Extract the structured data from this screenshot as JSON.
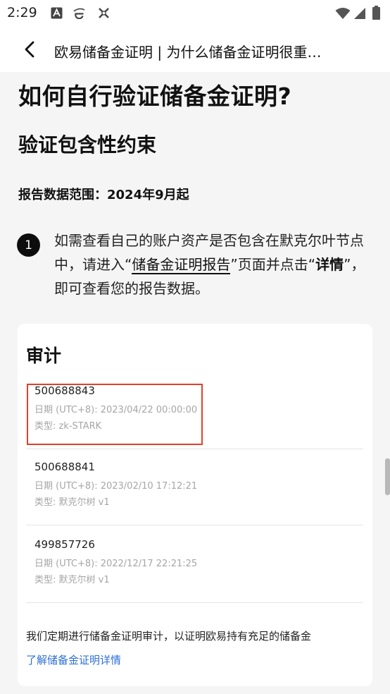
{
  "status_bar": {
    "time": "2:29",
    "left_icons": [
      "font-a-icon",
      "browser-e-icon",
      "xiaomi-icon"
    ],
    "right_icons": [
      "wifi-icon",
      "signal-icon",
      "battery-icon"
    ]
  },
  "app_bar": {
    "title": "欧易储备金证明 | 为什么储备金证明很重…"
  },
  "article": {
    "heading": "如何自行验证储备金证明?",
    "subheading": "验证包含性约束",
    "data_scope": "报告数据范围：2024年9月起",
    "step": {
      "number": "1",
      "text_before": "如需查看自己的账户资产是否包含在默克尔叶节点中，请进入“",
      "link_text": "储备金证明报告",
      "text_middle": "”页面并点击“",
      "bold_text": "详情",
      "text_after": "”，即可查看您的报告数据。"
    }
  },
  "audit_card": {
    "title": "审计",
    "records": [
      {
        "id": "500688843",
        "date": "日期 (UTC+8): 2023/04/22 00:00:00",
        "type": "类型: zk-STARK"
      },
      {
        "id": "500688841",
        "date": "日期 (UTC+8): 2023/02/10 17:12:21",
        "type": "类型: 默克尔树 v1"
      },
      {
        "id": "499857726",
        "date": "日期 (UTC+8): 2022/12/17 22:21:25",
        "type": "类型: 默克尔树 v1"
      }
    ],
    "description": "我们定期进行储备金证明审计，以证明欧易持有充足的储备金",
    "learn_more_link": "了解储备金证明详情"
  },
  "colors": {
    "highlight_border": "#e0402a",
    "link_blue": "#2d6fd6",
    "page_background": "#f5f5f5"
  }
}
